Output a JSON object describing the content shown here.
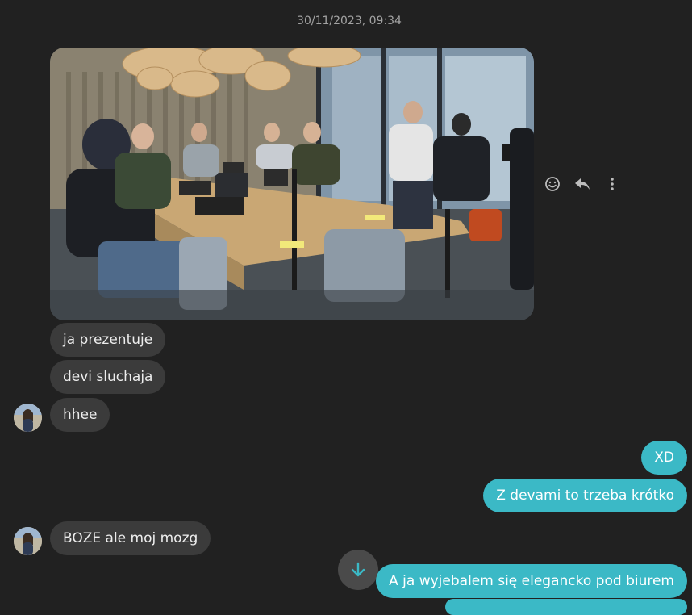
{
  "conversation": {
    "timestamp": "30/11/2023, 09:34",
    "incoming": [
      {
        "text": "ja prezentuje"
      },
      {
        "text": "devi sluchaja"
      },
      {
        "text": "hhee"
      },
      {
        "text": "BOZE ale moj mozg"
      }
    ],
    "outgoing": [
      {
        "text": "XD"
      },
      {
        "text": "Z devami to trzeba krótko"
      },
      {
        "text": "A ja wyjebalem się elegancko pod biurem"
      }
    ]
  },
  "icons": {
    "react": "emoji-smile-icon",
    "reply": "reply-arrow-icon",
    "more": "more-vertical-icon",
    "scroll": "arrow-down-icon"
  },
  "colors": {
    "background": "#212121",
    "incoming_bubble": "#3b3b3b",
    "outgoing_bubble": "#3bb9c6",
    "timestamp": "#a3a3a3"
  }
}
